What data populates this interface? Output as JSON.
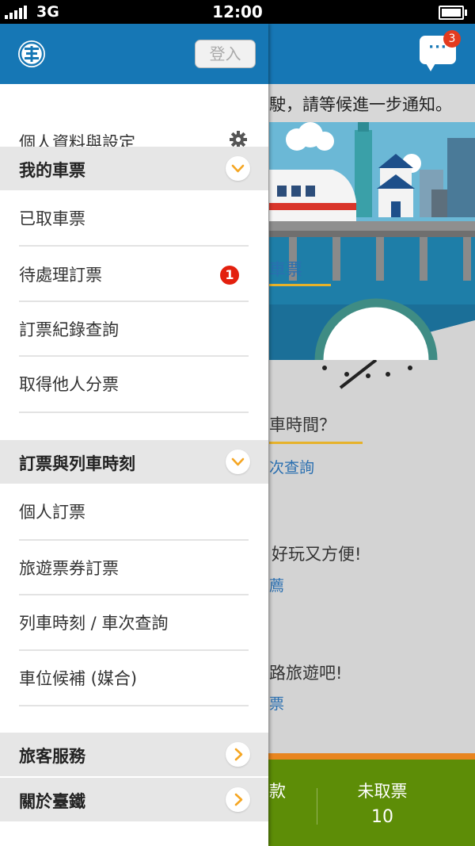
{
  "status_bar": {
    "carrier": "3G",
    "time": "12:00"
  },
  "drawer": {
    "login_label": "登入",
    "settings_label": "個人資料與設定",
    "sections": {
      "my_tickets": {
        "title": "我的車票",
        "items": [
          "已取車票",
          "待處理訂票",
          "訂票紀錄查詢",
          "取得他人分票"
        ],
        "pending_badge": "1"
      },
      "booking": {
        "title": "訂票與列車時刻",
        "items": [
          "個人訂票",
          "旅遊票券訂票",
          "列車時刻 / 車次查詢",
          "車位候補 (媒合)"
        ]
      },
      "services": {
        "title": "旅客服務"
      },
      "about": {
        "title": "關於臺鐵"
      }
    }
  },
  "background": {
    "message_badge": "3",
    "notice_text": "駛，請等候進一步通知。",
    "banner_tab": "車票",
    "question": "車時間？",
    "query_link": "次查詢",
    "promo1": "好玩又方便!",
    "promo1_link": "薦",
    "promo2": "路旅遊吧!",
    "promo2_link": "票",
    "footer_partial": "款",
    "footer_label": "未取票",
    "footer_count": "10"
  },
  "colors": {
    "brand_blue": "#1677b5",
    "accent_orange": "#f5a623",
    "badge_red": "#e3200e",
    "footer_green": "#5d8d07"
  }
}
